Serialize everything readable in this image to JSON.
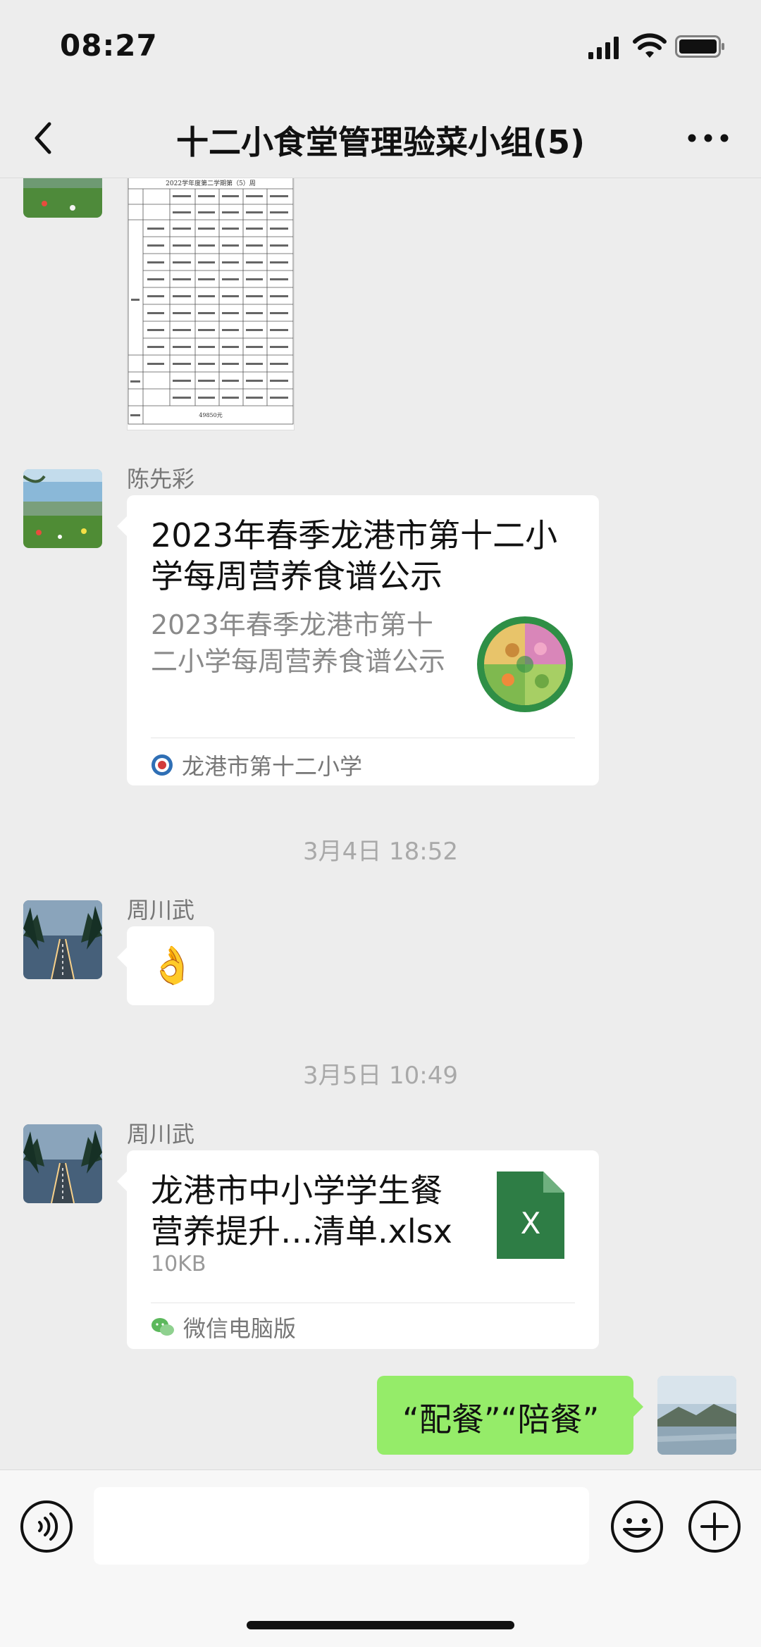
{
  "status_bar": {
    "time": "08:27"
  },
  "header": {
    "title": "十二小食堂管理验菜小组(5)"
  },
  "messages": {
    "image_msg": {
      "table_title": "2022学年度第二学期第（5）周",
      "total": "49850元"
    },
    "link_card": {
      "sender": "陈先彩",
      "title": "2023年春季龙港市第十二小学每周营养食谱公示",
      "description": "2023年春季龙港市第十二小学每周营养食谱公示",
      "source": "龙港市第十二小学"
    },
    "timestamp1": "3月4日 18:52",
    "ok_msg": {
      "sender": "周川武",
      "emoji": "👌"
    },
    "timestamp2": "3月5日 10:49",
    "file_msg": {
      "sender": "周川武",
      "file_name": "龙港市中小学学生餐营养提升…清单.xlsx",
      "file_size": "10KB",
      "file_icon_letter": "X",
      "source": "微信电脑版"
    },
    "self_msg": {
      "text": "“配餐”“陪餐”"
    }
  },
  "input_bar": {
    "placeholder": ""
  },
  "colors": {
    "background": "#ededed",
    "self_bubble": "#95ec69",
    "excel_green": "#2e7d45"
  },
  "icons": [
    "back-arrow-icon",
    "more-icon",
    "voice-icon",
    "emoji-icon",
    "add-icon",
    "signal-icon",
    "wifi-icon",
    "battery-icon",
    "wechat-icon",
    "school-logo-icon",
    "excel-file-icon"
  ]
}
